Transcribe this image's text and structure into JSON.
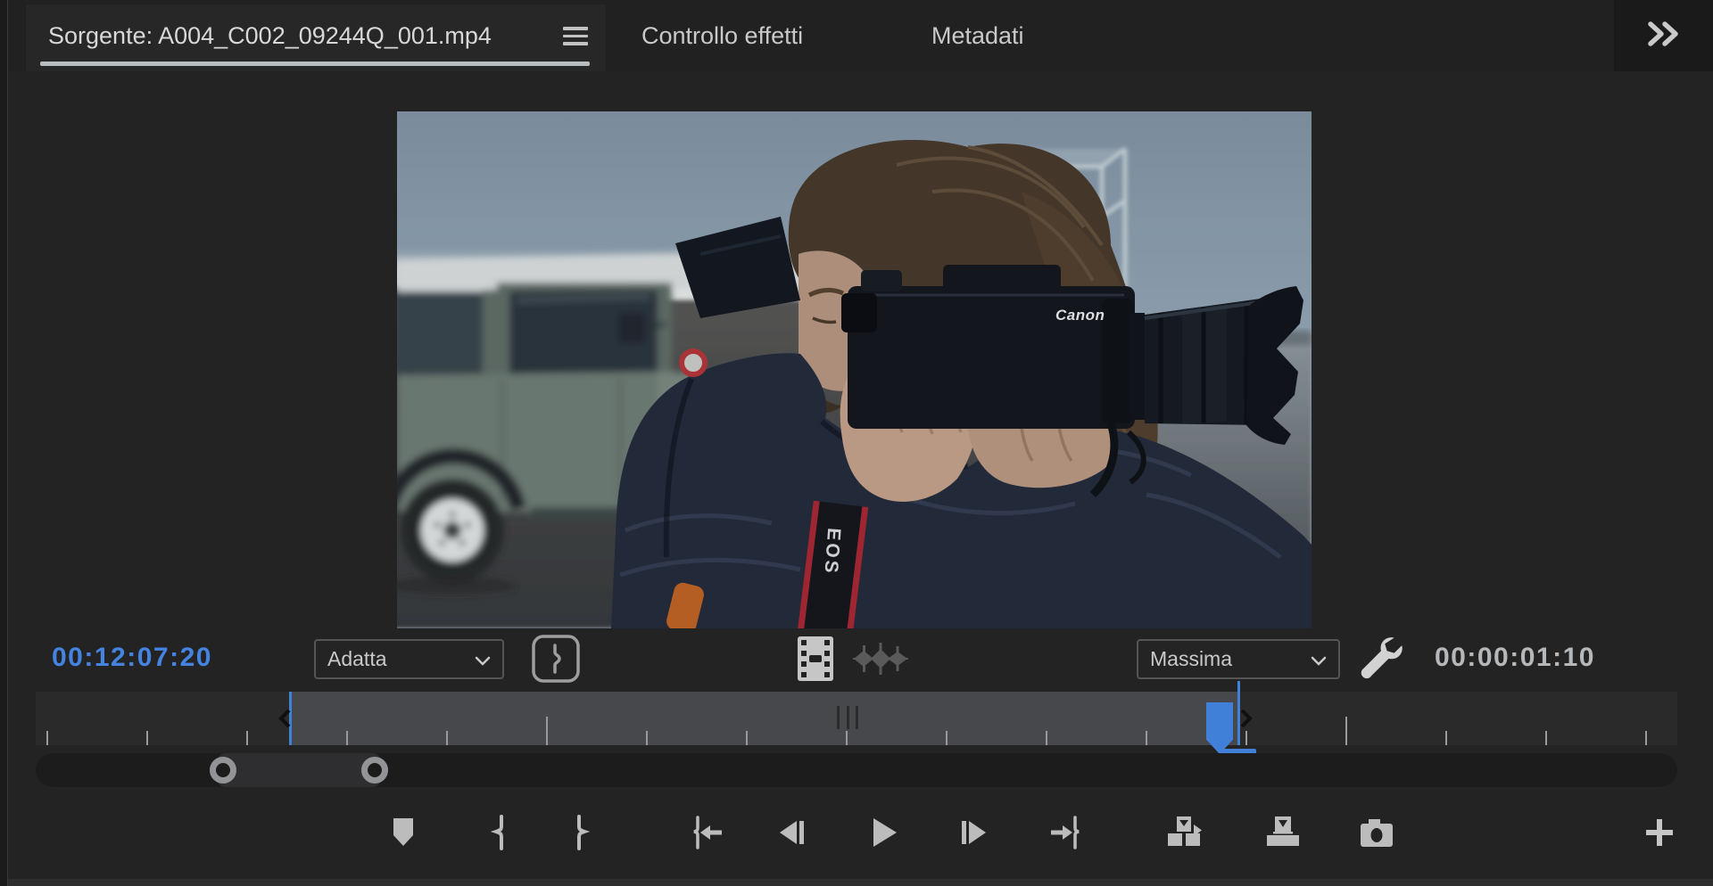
{
  "tabs": {
    "source": {
      "label": "Sorgente: A004_C002_09244Q_001.mp4",
      "active": true
    },
    "effects": {
      "label": "Controllo effetti",
      "active": false
    },
    "metadata": {
      "label": "Metadati",
      "active": false
    }
  },
  "panel_icons": [
    "hamburger-menu-icon",
    "double-chevron-overflow-icon"
  ],
  "monitor": {
    "current_timecode": "00:12:07:20",
    "duration": "00:00:01:10",
    "zoom_level": "Adatta",
    "playback_resolution": "Massima"
  },
  "control_icons": [
    "curly-brace-button",
    "drag-video-only",
    "drag-audio-only",
    "settings-wrench"
  ],
  "transport_buttons": [
    "add-marker",
    "mark-in",
    "mark-out",
    "go-to-in",
    "step-back",
    "play",
    "step-forward",
    "go-to-out",
    "insert",
    "overwrite",
    "export-frame",
    "button-editor"
  ],
  "video_frame": {
    "camera_brand_text": "Canon",
    "strap_text": "EOS"
  },
  "colors": {
    "accent_blue": "#4180D8",
    "timecode_blue": "#4583E0",
    "panel_bg": "#232323",
    "tabbar_bg": "#212121",
    "text_gray": "#C9C9C9",
    "range_bar": "#47484C",
    "active_tab_underline": "#B9BCBE"
  }
}
